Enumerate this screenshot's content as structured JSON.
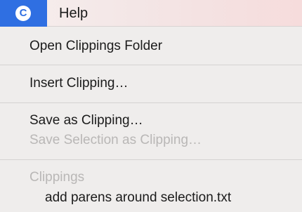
{
  "menubar": {
    "app_icon_letter": "C",
    "help_label": "Help"
  },
  "menu": {
    "open_folder": "Open Clippings Folder",
    "insert_clipping": "Insert Clipping…",
    "save_as_clipping": "Save as Clipping…",
    "save_selection": "Save Selection as Clipping…",
    "clippings_header": "Clippings",
    "clipping_file": "add parens around selection.txt"
  },
  "colors": {
    "accent": "#2f6fe2",
    "disabled_text": "#b9b7b6",
    "menu_background": "#efedec"
  }
}
